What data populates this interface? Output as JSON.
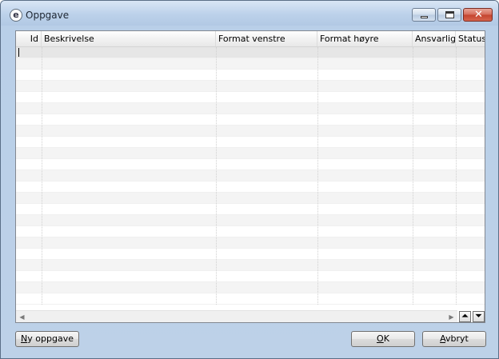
{
  "window": {
    "title": "Oppgave",
    "close_glyph": "✕"
  },
  "grid": {
    "columns": [
      {
        "label": "Id"
      },
      {
        "label": "Beskrivelse"
      },
      {
        "label": "Format venstre"
      },
      {
        "label": "Format høyre"
      },
      {
        "label": "Ansvarlig"
      },
      {
        "label": "Status"
      }
    ]
  },
  "nav": {
    "up_glyph": "⏶",
    "down_glyph": "⏷",
    "left_glyph": "◀",
    "right_glyph": "▶"
  },
  "buttons": {
    "new_task": {
      "accel": "N",
      "rest": "y oppgave"
    },
    "ok": {
      "accel": "O",
      "rest": "K"
    },
    "cancel": {
      "accel": "A",
      "rest": "vbryt"
    }
  },
  "icons": {
    "app": "e",
    "minimize": "minimize-icon",
    "maximize": "maximize-icon",
    "close": "close-icon"
  }
}
